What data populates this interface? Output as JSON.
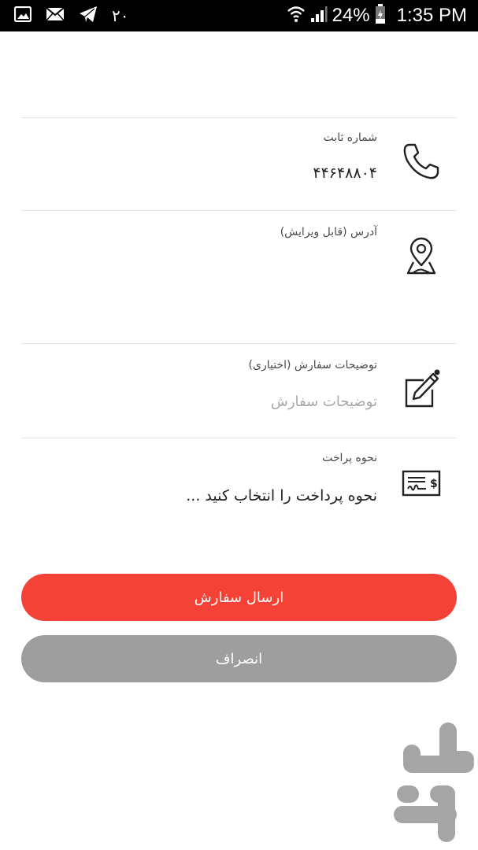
{
  "status_bar": {
    "notification_count": "۲۰",
    "battery": "24%",
    "time": "1:35 PM"
  },
  "form": {
    "phone": {
      "label": "شماره ثابت",
      "value": "۴۴۶۴۸۸۰۴"
    },
    "address": {
      "label": "آدرس (قابل ویرایش)",
      "value": ""
    },
    "notes": {
      "label": "توضیحات سفارش (اختیاری)",
      "placeholder": "توضیحات سفارش"
    },
    "payment": {
      "label": "نحوه پراخت",
      "value": "نحوه پرداخت را انتخاب کنید ..."
    }
  },
  "actions": {
    "submit_label": "ارسال سفارش",
    "cancel_label": "انصراف"
  },
  "colors": {
    "primary": "#f44336",
    "secondary": "#9e9e9e",
    "status_bar": "#000000"
  },
  "icons": {
    "phone": "phone-icon",
    "address": "map-pin-icon",
    "notes": "edit-icon",
    "payment": "check-payment-icon",
    "brand": "bazaar-logo-icon"
  }
}
